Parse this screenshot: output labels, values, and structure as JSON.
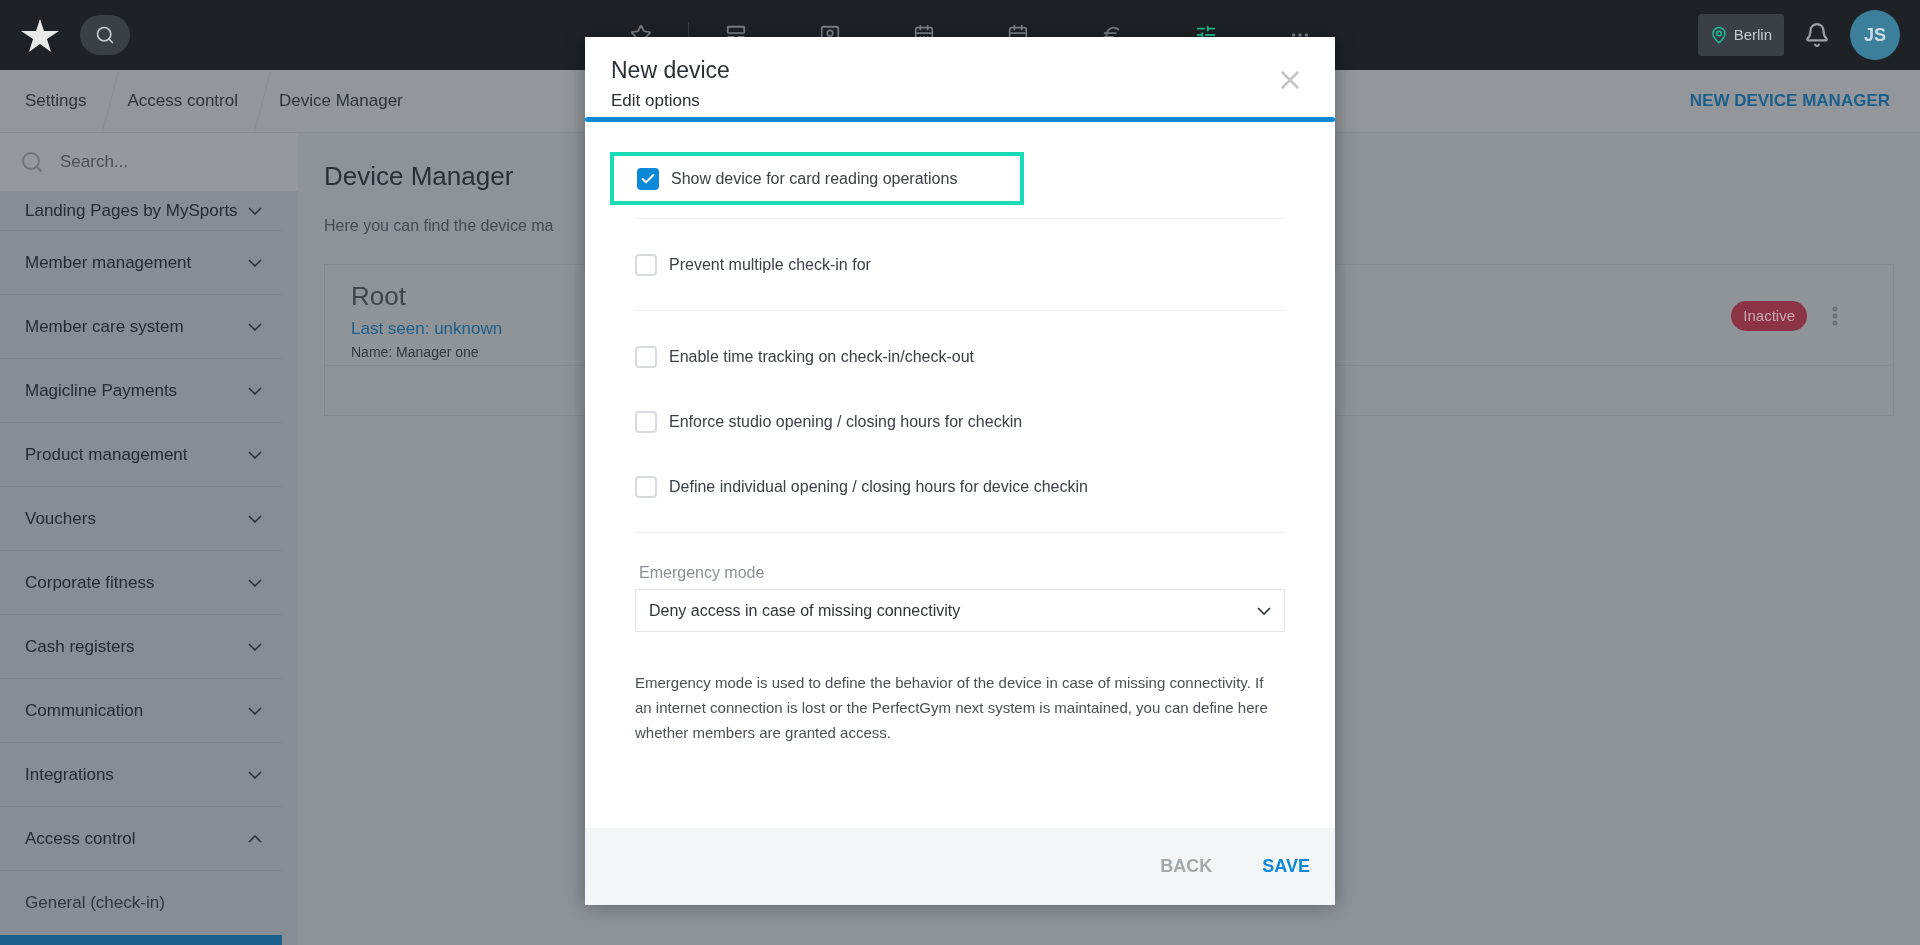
{
  "top_bar": {
    "nav_icons": [
      {
        "kind": "star",
        "selected": false
      },
      {
        "kind": "layout",
        "selected": false
      },
      {
        "kind": "member",
        "selected": false
      },
      {
        "kind": "calendar-day",
        "selected": false
      },
      {
        "kind": "calendar",
        "selected": false
      },
      {
        "kind": "euro",
        "selected": false
      },
      {
        "kind": "sliders",
        "selected": true
      },
      {
        "kind": "more",
        "selected": false
      }
    ],
    "location": "Berlin",
    "avatar_initials": "JS"
  },
  "breadcrumbs": [
    "Settings",
    "Access control",
    "Device Manager"
  ],
  "header_action": "NEW DEVICE MANAGER",
  "sidebar": {
    "search_placeholder": "Search...",
    "items": [
      {
        "label": "Landing Pages by MySports",
        "expanded": false
      },
      {
        "label": "Member management",
        "expanded": false
      },
      {
        "label": "Member care system",
        "expanded": false
      },
      {
        "label": "Magicline Payments",
        "expanded": false
      },
      {
        "label": "Product management",
        "expanded": false
      },
      {
        "label": "Vouchers",
        "expanded": false
      },
      {
        "label": "Corporate fitness",
        "expanded": false
      },
      {
        "label": "Cash registers",
        "expanded": false
      },
      {
        "label": "Communication",
        "expanded": false
      },
      {
        "label": "Integrations",
        "expanded": false
      },
      {
        "label": "Access control",
        "expanded": true
      }
    ],
    "subitems": [
      {
        "label": "General (check-in)",
        "selected": false
      }
    ]
  },
  "main": {
    "title": "Device Manager",
    "description": "Here you can find the device ma",
    "card": {
      "name": "Root",
      "last_seen": "Last seen: unknown",
      "meta": "Name: Manager one",
      "status": "Inactive"
    }
  },
  "modal": {
    "title": "New device",
    "subtitle": "Edit options",
    "option_groups": [
      {
        "options": [
          {
            "label": "Show device for card reading operations",
            "checked": true,
            "highlighted": true
          }
        ]
      },
      {
        "options": [
          {
            "label": "Prevent multiple check-in for",
            "checked": false,
            "highlighted": false
          }
        ]
      },
      {
        "options": [
          {
            "label": "Enable time tracking on check-in/check-out",
            "checked": false,
            "highlighted": false
          },
          {
            "label": "Enforce studio opening / closing hours for checkin",
            "checked": false,
            "highlighted": false
          },
          {
            "label": "Define individual opening / closing hours for device checkin",
            "checked": false,
            "highlighted": false
          }
        ]
      }
    ],
    "emergency_label": "Emergency mode",
    "emergency_value": "Deny access in case of missing connectivity",
    "help": "Emergency mode is used to define the behavior of the device in case of missing connectivity. If an internet connection is lost or the PerfectGym next system is maintained, you can define here whether members are granted access.",
    "buttons": [
      {
        "label": "BACK",
        "kind": "secondary"
      },
      {
        "label": "SAVE",
        "kind": "primary"
      }
    ]
  }
}
